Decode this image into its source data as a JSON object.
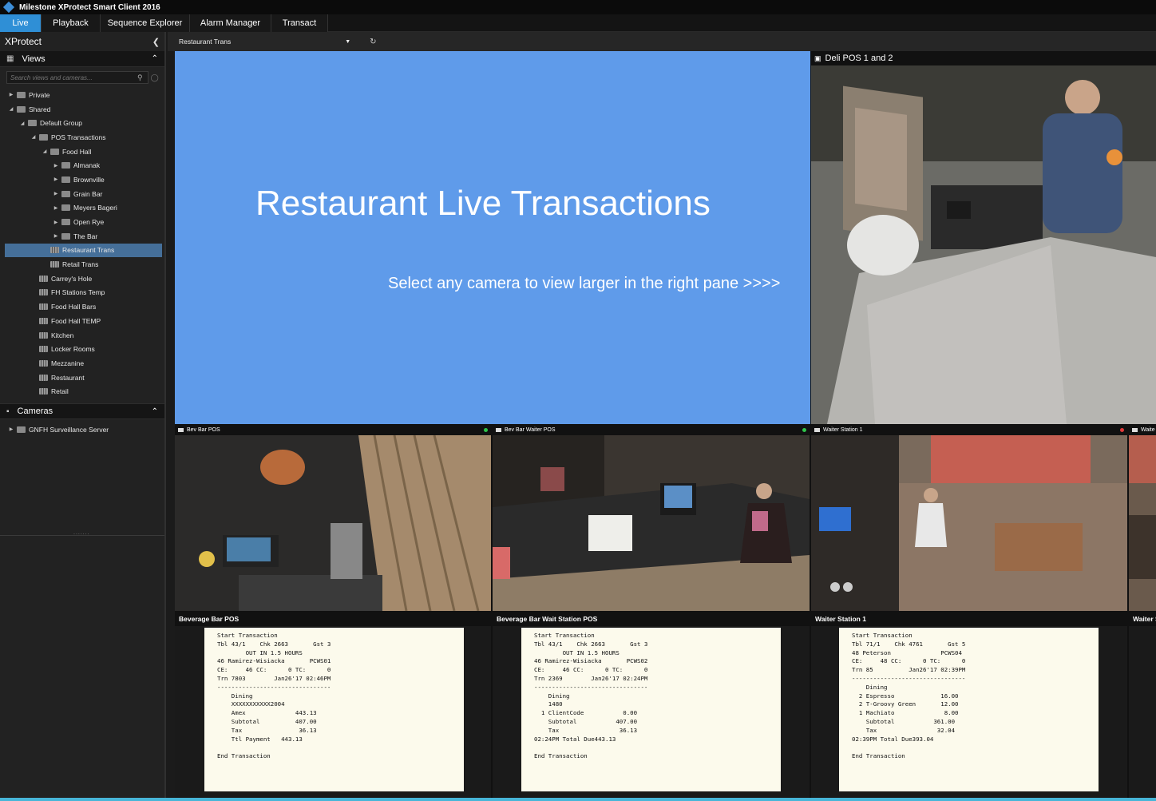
{
  "app": {
    "title": "Milestone XProtect Smart Client 2016"
  },
  "tabs": [
    "Live",
    "Playback",
    "Sequence Explorer",
    "Alarm Manager",
    "Transact"
  ],
  "sidebar": {
    "header": "XProtect",
    "views_label": "Views",
    "search_placeholder": "Search views and cameras...",
    "tree": [
      {
        "label": "Private",
        "level": 0,
        "arrow": "right",
        "icon": "folder"
      },
      {
        "label": "Shared",
        "level": 0,
        "arrow": "down",
        "icon": "folder"
      },
      {
        "label": "Default Group",
        "level": 1,
        "arrow": "down",
        "icon": "folder"
      },
      {
        "label": "POS Transactions",
        "level": 2,
        "arrow": "down",
        "icon": "folder"
      },
      {
        "label": "Food Hall",
        "level": 3,
        "arrow": "down",
        "icon": "folder"
      },
      {
        "label": "Almanak",
        "level": 4,
        "arrow": "right",
        "icon": "folder"
      },
      {
        "label": "Brownville",
        "level": 4,
        "arrow": "right",
        "icon": "folder"
      },
      {
        "label": "Grain Bar",
        "level": 4,
        "arrow": "right",
        "icon": "folder"
      },
      {
        "label": "Meyers Bageri",
        "level": 4,
        "arrow": "right",
        "icon": "folder"
      },
      {
        "label": "Open Rye",
        "level": 4,
        "arrow": "right",
        "icon": "folder"
      },
      {
        "label": "The Bar",
        "level": 4,
        "arrow": "right",
        "icon": "folder"
      },
      {
        "label": "Restaurant Trans",
        "level": 3,
        "arrow": "",
        "icon": "view",
        "selected": true
      },
      {
        "label": "Retail Trans",
        "level": 3,
        "arrow": "",
        "icon": "view"
      },
      {
        "label": "Carrey's Hole",
        "level": 2,
        "arrow": "",
        "icon": "view"
      },
      {
        "label": "FH Stations Temp",
        "level": 2,
        "arrow": "",
        "icon": "view"
      },
      {
        "label": "Food Hall Bars",
        "level": 2,
        "arrow": "",
        "icon": "view"
      },
      {
        "label": "Food Hall TEMP",
        "level": 2,
        "arrow": "",
        "icon": "view"
      },
      {
        "label": "Kitchen",
        "level": 2,
        "arrow": "",
        "icon": "view"
      },
      {
        "label": "Locker Rooms",
        "level": 2,
        "arrow": "",
        "icon": "view"
      },
      {
        "label": "Mezzanine",
        "level": 2,
        "arrow": "",
        "icon": "view"
      },
      {
        "label": "Restaurant",
        "level": 2,
        "arrow": "",
        "icon": "view"
      },
      {
        "label": "Retail",
        "level": 2,
        "arrow": "",
        "icon": "view"
      }
    ],
    "cameras_label": "Cameras",
    "camera_tree": [
      {
        "label": "GNFH Surveillance Server",
        "level": 0,
        "arrow": "right",
        "icon": "server"
      }
    ]
  },
  "view_selector": {
    "value": "Restaurant Trans"
  },
  "banner": {
    "title": "Restaurant Live Transactions",
    "subtitle": "Select any camera to view larger in the right pane >>>>"
  },
  "hotspot": {
    "title": "Deli POS 1 and 2"
  },
  "cameras": [
    {
      "name": "Bev Bar POS"
    },
    {
      "name": "Bev Bar Waiter POS"
    },
    {
      "name": "Waiter Station 1"
    },
    {
      "name": "Waite"
    }
  ],
  "receipts": [
    {
      "title": "Beverage Bar POS",
      "text": "Start Transaction\nTbl 43/1    Chk 2663       Gst 3\n        OUT IN 1.5 HOURS\n46 Ramirez-Wisiacka       PCWS01\nCE:     46 CC:      0 TC:      0\nTrn 7803        Jan26'17 02:46PM\n--------------------------------\n    Dining\n    XXXXXXXXXXX2004\n    Amex              443.13\n    Subtotal          407.00\n    Tax                36.13\n    Ttl Payment   443.13\n\nEnd Transaction"
    },
    {
      "title": "Beverage Bar Wait Station POS",
      "text": "Start Transaction\nTbl 43/1    Chk 2663       Gst 3\n        OUT IN 1.5 HOURS\n46 Ramirez-Wisiacka       PCWS02\nCE:     46 CC:      0 TC:      0\nTrn 2369        Jan26'17 02:24PM\n--------------------------------\n    Dining\n    1480\n  1 ClientCode           0.00\n    Subtotal           407.00\n    Tax                 36.13\n02:24PM Total Due443.13\n\nEnd Transaction"
    },
    {
      "title": "Waiter Station 1",
      "text": "Start Transaction\nTbl 71/1    Chk 4761       Gst 5\n48 Peterson              PCWS04\nCE:     48 CC:      0 TC:      0\nTrn 85          Jan26'17 02:39PM\n--------------------------------\n    Dining\n  2 Espresso             16.00\n  2 T-Groovy Green       12.00\n  1 Machiato              8.00\n    Subtotal           361.00\n    Tax                 32.04\n02:39PM Total Due393.04\n\nEnd Transaction"
    },
    {
      "title": "Waiter S"
    }
  ],
  "colors": {
    "accent": "#2f8fd6",
    "banner": "#5f9bea",
    "selection": "#456f99",
    "receipt_bg": "#fcfaec"
  }
}
